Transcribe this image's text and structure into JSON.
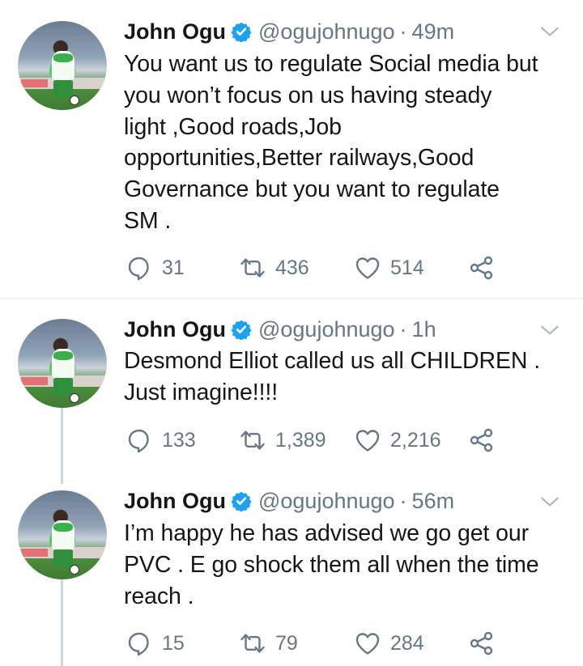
{
  "tweets": [
    {
      "name": "John Ogu",
      "handle": "@ogujohnugo",
      "separator": "·",
      "time": "49m",
      "text": "You want us to regulate Social media but\nyou won’t focus on us having steady\nlight ,Good roads,Job\nopportunities,Better railways,Good\nGovernance but you want to regulate\nSM .",
      "replies": "31",
      "retweets": "436",
      "likes": "514"
    },
    {
      "name": "John Ogu",
      "handle": "@ogujohnugo",
      "separator": "·",
      "time": "1h",
      "text": "Desmond Elliot called us all CHILDREN .\nJust imagine!!!!",
      "replies": "133",
      "retweets": "1,389",
      "likes": "2,216"
    },
    {
      "name": "John Ogu",
      "handle": "@ogujohnugo",
      "separator": "·",
      "time": "56m",
      "text": "I’m happy he has advised we go get our\nPVC . E go shock them all when the time\nreach .",
      "replies": "15",
      "retweets": "79",
      "likes": "284"
    }
  ],
  "icons": {
    "verified": "verified-badge-icon",
    "caret": "chevron-down-icon",
    "reply": "reply-icon",
    "retweet": "retweet-icon",
    "like": "heart-icon",
    "share": "share-icon"
  },
  "colors": {
    "verified": "#1da1f2",
    "secondary_text": "#657786",
    "divider": "#e6ecf0",
    "thread_line": "#ccd6dd"
  }
}
